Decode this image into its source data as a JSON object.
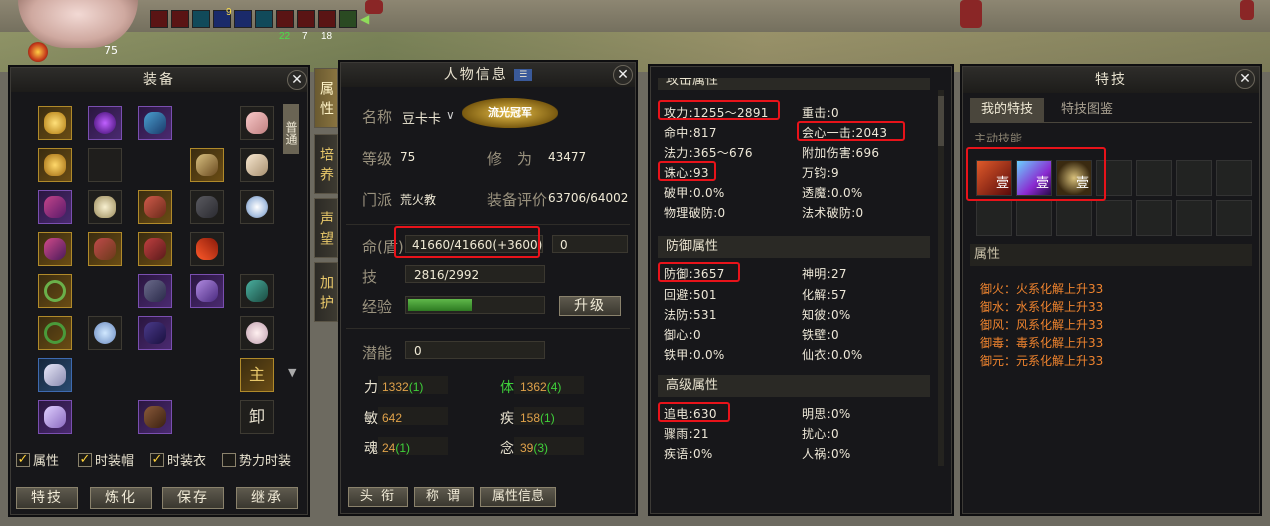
{
  "hud": {
    "level": "75",
    "buff_counts": [
      "22",
      "7",
      "18"
    ],
    "buff_label": "9"
  },
  "equip": {
    "title": "装备",
    "side_tab": "普通",
    "main_label": "主",
    "unload_label": "卸",
    "checkboxes": [
      {
        "label": "属性",
        "checked": true
      },
      {
        "label": "时装帽",
        "checked": true
      },
      {
        "label": "时装衣",
        "checked": true
      },
      {
        "label": "势力时装",
        "checked": false
      }
    ],
    "buttons": [
      "特技",
      "炼化",
      "保存",
      "继承"
    ]
  },
  "vtabs": [
    "属性",
    "培养",
    "声望",
    "加护"
  ],
  "char": {
    "title": "人物信息",
    "name_label": "名称",
    "name": "豆卡卡",
    "badge": "流光冠军",
    "level_label": "等级",
    "level": "75",
    "cultivation_label": "修　为",
    "cultivation": "43477",
    "sect_label": "门派",
    "sect": "荒火教",
    "gear_label": "装备评价",
    "gear": "63706/64002",
    "hp_label": "命(盾)",
    "hp": "41660/41660(+3600)",
    "shield": "0",
    "skill_label": "技",
    "skill": "2816/2992",
    "exp_label": "经验",
    "exp_fill": 0.48,
    "upgrade": "升级",
    "potential_label": "潜能",
    "potential": "0",
    "attrs": [
      {
        "label": "力",
        "value": "1332",
        "extra": "(1)",
        "color": "#e0a24a"
      },
      {
        "label": "体",
        "value": "1362",
        "extra": "(4)",
        "color": "#e0a24a",
        "label_color": "#3fd13a"
      },
      {
        "label": "敏",
        "value": "642",
        "extra": "",
        "color": "#e0a24a"
      },
      {
        "label": "疾",
        "value": "158",
        "extra": "(1)",
        "color": "#e0a24a"
      },
      {
        "label": "魂",
        "value": "24",
        "extra": "(1)",
        "color": "#e0a24a"
      },
      {
        "label": "念",
        "value": "39",
        "extra": "(3)",
        "color": "#e0a24a"
      }
    ],
    "buttons": [
      "头 衔",
      "称 谓",
      "属性信息"
    ]
  },
  "stats": {
    "top_cut": "攻击属性",
    "attack": [
      [
        "攻力:1255～2891",
        "重击:0"
      ],
      [
        "命中:817",
        "会心一击:2043"
      ],
      [
        "法力:365～676",
        "附加伤害:696"
      ],
      [
        "诛心:93",
        "万钧:9"
      ],
      [
        "破甲:0.0%",
        "透魔:0.0%"
      ],
      [
        "物理破防:0",
        "法术破防:0"
      ]
    ],
    "defense_title": "防御属性",
    "defense": [
      [
        "防御:3657",
        "神明:27"
      ],
      [
        "回避:501",
        "化解:57"
      ],
      [
        "法防:531",
        "知彼:0%"
      ],
      [
        "御心:0",
        "铁壁:0"
      ],
      [
        "铁甲:0.0%",
        "仙衣:0.0%"
      ]
    ],
    "advanced_title": "高级属性",
    "advanced": [
      [
        "追电:630",
        "明思:0%"
      ],
      [
        "骤雨:21",
        "扰心:0"
      ],
      [
        "疾语:0%",
        "人祸:0%"
      ]
    ]
  },
  "tech": {
    "title": "特技",
    "tabs": [
      "我的特技",
      "特技图鉴"
    ],
    "active_label": "主动技能",
    "skill_glyph": "壹",
    "attr_label": "属性",
    "attrs": [
      "御火：火系化解上升33",
      "御水：水系化解上升33",
      "御风：风系化解上升33",
      "御毒：毒系化解上升33",
      "御元：元系化解上升33"
    ]
  },
  "colors": {
    "highlight": "#e8131a",
    "attr_orange": "#f0842e",
    "gold": "#e0a24a",
    "green": "#3fd13a"
  }
}
